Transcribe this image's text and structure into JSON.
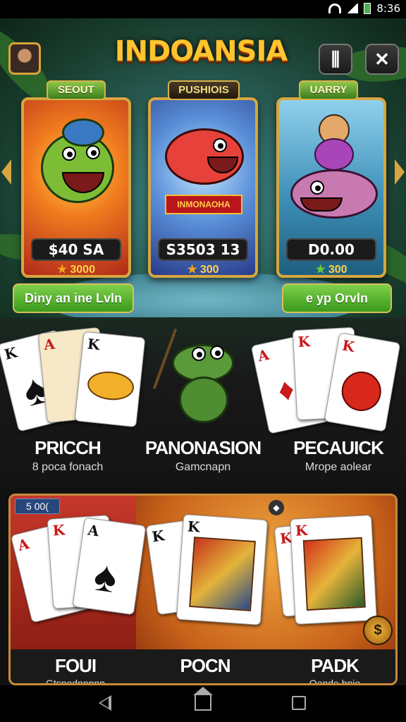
{
  "status_bar": {
    "time": "8:36"
  },
  "header": {
    "logo_text": "INDOANSIA",
    "menu_icon": "pillars-icon",
    "close_icon": "close-icon"
  },
  "featured": [
    {
      "banner": "SEOUT",
      "price": "$40 SA",
      "coins": "3000",
      "label": ""
    },
    {
      "banner": "PUSHIOIS",
      "price": "S3503 13",
      "coins": "300",
      "label": "INMONAOHA"
    },
    {
      "banner": "UARRY",
      "price": "D0.00",
      "coins": "300",
      "label": ""
    }
  ],
  "pills": {
    "left": "Diny an ine Lvln",
    "right": "e yp Orvln"
  },
  "games": [
    {
      "title": "PRICCH",
      "subtitle": "8 poca fonach"
    },
    {
      "title": "PANONASION",
      "subtitle": "Gamcnapn"
    },
    {
      "title": "PECAUICK",
      "subtitle": "Mrope aolear"
    }
  ],
  "bottom_panel": {
    "tag": "5 00(",
    "tables": [
      {
        "title": "FOUI",
        "subtitle": "Gtsnodnnpnp"
      },
      {
        "title": "POCN",
        "subtitle": ""
      },
      {
        "title": "PADK",
        "subtitle": "Qande bnio"
      }
    ]
  },
  "colors": {
    "gold": "#d7a640",
    "green": "#5cb32a",
    "logo": "#ffc42e"
  }
}
